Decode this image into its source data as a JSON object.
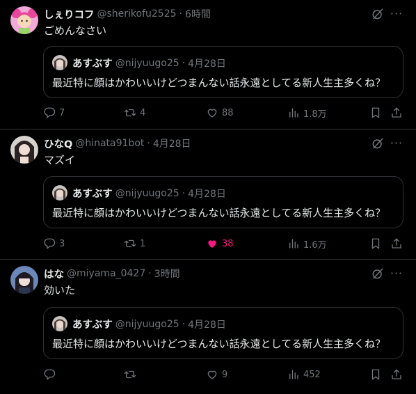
{
  "quoted": {
    "name": "あすぶす",
    "handle": "@nijyuugo25",
    "time": "4月28日",
    "text": "最近特に顔はかわいいけどつまんない話永遠としてる新人生主多くね？"
  },
  "posts": [
    {
      "name": "しぇりコフ",
      "handle": "@sherikofu2525",
      "time": "6時間",
      "text": "ごめんなさい",
      "replies": "7",
      "reposts": "4",
      "likes": "88",
      "views": "1.8万",
      "liked": false
    },
    {
      "name": "ひなQ",
      "handle": "@hinata91bot",
      "time": "4月28日",
      "text": "マズイ",
      "replies": "3",
      "reposts": "1",
      "likes": "38",
      "views": "1.6万",
      "liked": true
    },
    {
      "name": "はな",
      "handle": "@miyama_0427",
      "time": "3時間",
      "text": "効いた",
      "replies": "",
      "reposts": "",
      "likes": "9",
      "views": "452",
      "liked": false
    }
  ],
  "colors": {
    "background": "#000000",
    "text": "#e7e9ea",
    "muted": "#71767b",
    "border": "#2f3336",
    "like_active": "#f91880"
  },
  "icons": [
    "grok-icon",
    "more-icon",
    "reply-icon",
    "repost-icon",
    "like-icon",
    "views-icon",
    "bookmark-icon",
    "share-icon"
  ]
}
